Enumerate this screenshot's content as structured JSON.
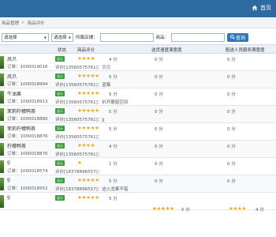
{
  "topbar": {
    "home_label": "首页"
  },
  "breadcrumb": {
    "item1": "商品管理",
    "item2": "商品评价"
  },
  "filters": {
    "select1": "请选择",
    "select2": "请选择",
    "shop_label": "所属店铺：",
    "product_label": "商品：",
    "query_button": "查询"
  },
  "table": {
    "headers": {
      "status": "状态",
      "product_score": "商品评分",
      "delivery_score": "送货速度满意度",
      "service_score": "配送人员服务满意度"
    },
    "rows": [
      {
        "name": "凤爪",
        "order": "订单：1000019016",
        "badge": "显示",
        "stars": "★★★★",
        "score": "4 分",
        "comment": "评价[13560575761]：贝贝",
        "c3": "0 分",
        "c4": "0 分"
      },
      {
        "name": "凤爪",
        "order": "订单：1000018994",
        "badge": "显示",
        "stars": "★★★★★",
        "score": "5 分",
        "comment": "评价[13560575761]：蓝莓",
        "c3": "0 分",
        "c4": "0 分"
      },
      {
        "name": "牛油果",
        "order": "订单：1000018913",
        "badge": "显示",
        "stars": "★★★★★",
        "score": "5 分",
        "comment": "评价[13560575761]：扒开蘑菇空间",
        "c3": "0 分",
        "c4": "0 分"
      },
      {
        "name": "茉莉柠檬鸭茶",
        "order": "订单：1000018880",
        "badge": "显示",
        "stars": "★★★★★",
        "score": "5 分",
        "comment": "评价[13560575761]：jj",
        "c3": "0 分",
        "c4": "0 分"
      },
      {
        "name": "茉莉柠檬鸭茶",
        "order": "订单：1000018876",
        "badge": "显示",
        "stars": "★★★★★",
        "score": "5 分",
        "comment": "评价[13560575761]：",
        "c3": "0 分",
        "c4": "0 分"
      },
      {
        "name": "柠檬鸭茶",
        "order": "订单：1000018876",
        "badge": "显示",
        "stars": "★★★★",
        "score": "4 分",
        "comment": "评价[13560575761]：",
        "c3": "0 分",
        "c4": "0 分"
      },
      {
        "name": "g",
        "order": "订单：1000018574",
        "badge": "显示",
        "stars": "★",
        "score": "1 分",
        "comment": "评价[18378896557]：",
        "c3": "0 分",
        "c4": "0 分"
      },
      {
        "name": "g",
        "order": "订单：1000018552",
        "badge": "显示",
        "stars": "★★★★★",
        "score": "5 分",
        "comment": "评价[18378896557]：这火龙果不错",
        "c3": "0 分",
        "c4": "0 分"
      },
      {
        "name": "g",
        "order": "",
        "badge": "显示",
        "stars": "★★★★★",
        "score": "5 分",
        "comment": "",
        "c3stars": "★★★★★",
        "c3score": "5 分",
        "c4stars": "★★★★",
        "c4score": "4 分"
      }
    ]
  }
}
